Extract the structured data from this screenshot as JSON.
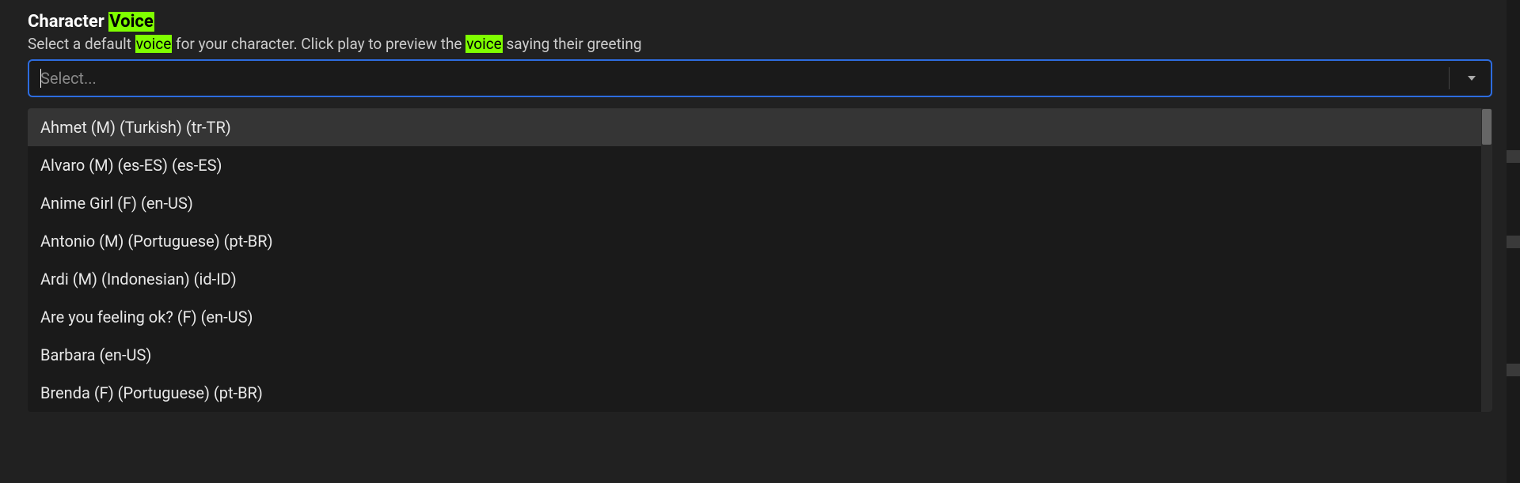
{
  "header": {
    "title_prefix": "Character ",
    "title_highlight": "Voice",
    "subtitle_parts": {
      "p1": "Select a default ",
      "h1": "voice",
      "p2": " for your character. Click play to preview the ",
      "h2": "voice",
      "p3": " saying their greeting"
    }
  },
  "select": {
    "placeholder": "Select..."
  },
  "options": [
    {
      "label": "Ahmet (M) (Turkish) (tr-TR)",
      "hovered": true
    },
    {
      "label": "Alvaro (M) (es-ES) (es-ES)",
      "hovered": false
    },
    {
      "label": "Anime Girl (F) (en-US)",
      "hovered": false
    },
    {
      "label": "Antonio (M) (Portuguese) (pt-BR)",
      "hovered": false
    },
    {
      "label": "Ardi (M) (Indonesian) (id-ID)",
      "hovered": false
    },
    {
      "label": "Are you feeling ok? (F) (en-US)",
      "hovered": false
    },
    {
      "label": "Barbara (en-US)",
      "hovered": false
    },
    {
      "label": "Brenda (F) (Portuguese) (pt-BR)",
      "hovered": false
    }
  ]
}
